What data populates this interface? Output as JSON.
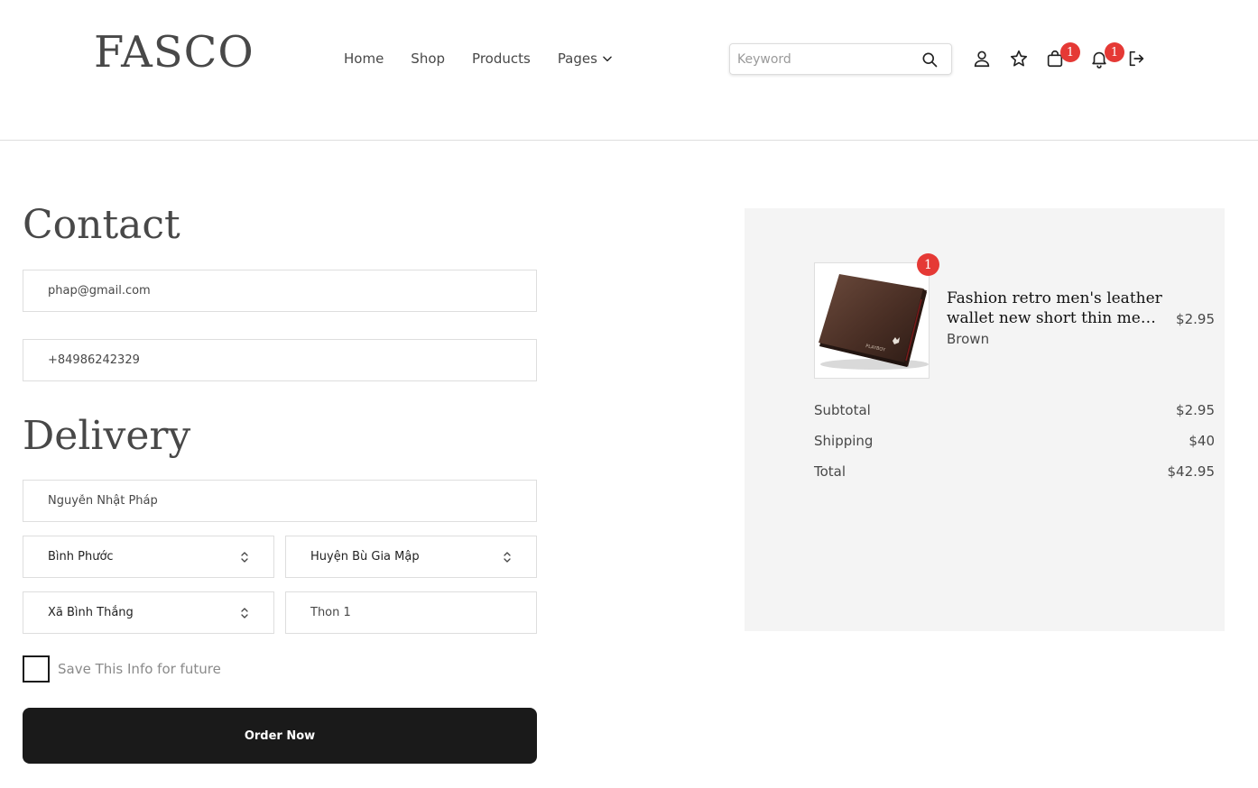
{
  "header": {
    "logo": "FASCO",
    "nav": [
      "Home",
      "Shop",
      "Products",
      "Pages"
    ],
    "search_placeholder": "Keyword",
    "cart_count": "1",
    "notification_count": "1"
  },
  "contact": {
    "title": "Contact",
    "email": "phap@gmail.com",
    "phone": "+84986242329"
  },
  "delivery": {
    "title": "Delivery",
    "name": "Nguyễn Nhật Pháp",
    "province": "Bình Phước",
    "district": "Huyện Bù Gia Mập",
    "ward": "Xã Bình Thắng",
    "address": "Thon 1"
  },
  "save_info_label": "Save This Info for future",
  "order_button": "Order Now",
  "summary": {
    "item": {
      "quantity": "1",
      "name_line1": "Fashion retro men's leather",
      "name_line2": "wallet new short thin men's...",
      "color": "Brown",
      "price": "$2.95",
      "brand": "PLAYBOY"
    },
    "subtotal_label": "Subtotal",
    "subtotal": "$2.95",
    "shipping_label": "Shipping",
    "shipping": "$40",
    "total_label": "Total",
    "total": "$42.95"
  }
}
